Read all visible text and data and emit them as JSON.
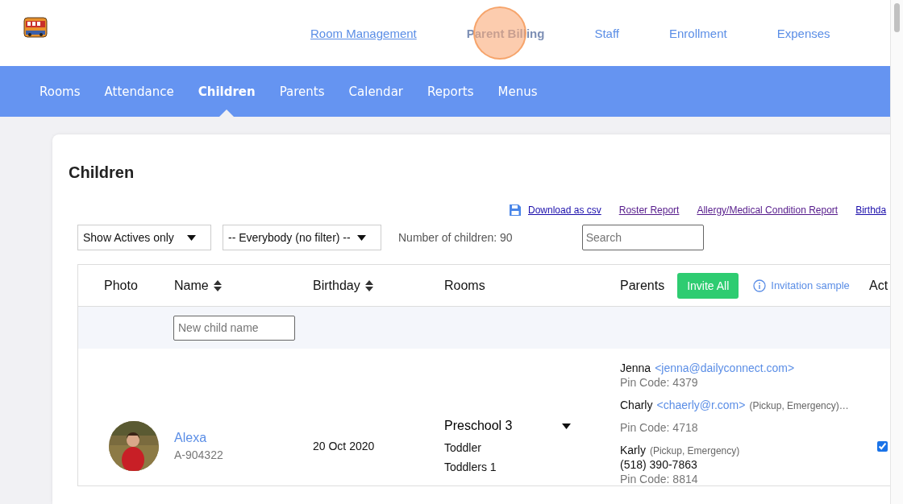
{
  "top_nav": [
    {
      "label": "Room Management",
      "selected": false,
      "hovered": true,
      "clicked": false
    },
    {
      "label": "Parent Billing",
      "selected": true,
      "hovered": false,
      "clicked": true
    },
    {
      "label": "Staff",
      "selected": false,
      "hovered": false,
      "clicked": false
    },
    {
      "label": "Enrollment",
      "selected": false,
      "hovered": false,
      "clicked": false
    },
    {
      "label": "Expenses",
      "selected": false,
      "hovered": false,
      "clicked": false
    }
  ],
  "tabs": [
    {
      "label": "Rooms",
      "selected": false
    },
    {
      "label": "Attendance",
      "selected": false
    },
    {
      "label": "Children",
      "selected": true
    },
    {
      "label": "Parents",
      "selected": false
    },
    {
      "label": "Calendar",
      "selected": false
    },
    {
      "label": "Reports",
      "selected": false
    },
    {
      "label": "Menus",
      "selected": false
    }
  ],
  "page_title": "Children",
  "report_links": [
    {
      "label": "Download as csv",
      "kind": "download",
      "visited": false
    },
    {
      "label": "Roster Report",
      "kind": "link",
      "visited": true
    },
    {
      "label": "Allergy/Medical Condition Report",
      "kind": "link",
      "visited": true
    },
    {
      "label": "Birthda",
      "kind": "link",
      "visited": false
    }
  ],
  "filters": [
    {
      "value": "Show Actives only"
    },
    {
      "value": "-- Everybody (no filter) --"
    }
  ],
  "children_count": "Number of children: 90",
  "search": {
    "placeholder": "Search"
  },
  "table": {
    "columns": [
      {
        "label": "Photo",
        "sortable": false
      },
      {
        "label": "Name",
        "sortable": true
      },
      {
        "label": "Birthday",
        "sortable": true
      },
      {
        "label": "Rooms",
        "sortable": false
      },
      {
        "label": "Parents",
        "sortable": false
      },
      {
        "label": "Act"
      }
    ],
    "invite_button": "Invite All",
    "invitation_link": "Invitation sample",
    "new_child": {
      "placeholder": "New child name"
    },
    "rows": [
      {
        "name": "Alexa",
        "code": "A-904322",
        "birthday": "20 Oct 2020",
        "rooms": [
          "Preschool 3",
          "Toddler",
          "Toddlers 1"
        ],
        "active": true,
        "parents": [
          {
            "name": "Jenna",
            "email": "<jenna@dailyconnect.com>",
            "pin": "Pin Code: 4379"
          },
          {
            "name": "Charly",
            "email": "<chaerly@r.com>",
            "roles": "(Pickup, Emergency)…",
            "pin": "Pin Code: 4718"
          },
          {
            "name": "Karly",
            "roles": "(Pickup, Emergency)",
            "phone": "(518) 390-7863",
            "pin": "Pin Code: 8814"
          }
        ]
      }
    ]
  }
}
